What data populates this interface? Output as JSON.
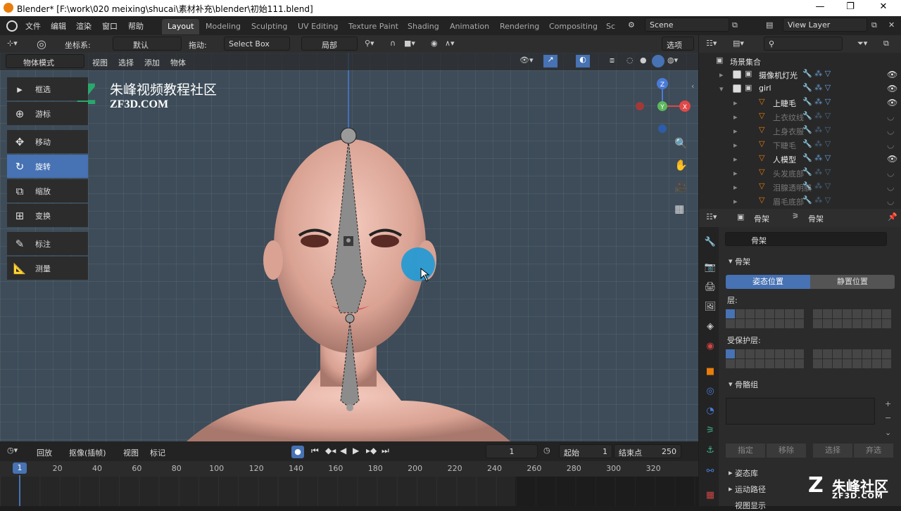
{
  "titlebar": {
    "title": "Blender* [F:\\work\\020 meixing\\shucai\\素材补充\\blender\\初始111.blend]",
    "min": "—",
    "max": "❐",
    "close": "✕"
  },
  "menu": {
    "items": [
      "文件",
      "编辑",
      "渲染",
      "窗口",
      "帮助"
    ]
  },
  "workspaces": [
    "Layout",
    "Modeling",
    "Sculpting",
    "UV Editing",
    "Texture Paint",
    "Shading",
    "Animation",
    "Rendering",
    "Compositing",
    "Sc"
  ],
  "scene": {
    "label": "Scene"
  },
  "viewlayer": {
    "label": "View Layer"
  },
  "viewport_header": {
    "coord_label": "坐标系:",
    "coord_value": "默认",
    "drag_label": "拖动:",
    "drag_value": "Select Box",
    "local_label": "局部",
    "options": "选项",
    "mode": "物体模式",
    "menus": [
      "视图",
      "选择",
      "添加",
      "物体"
    ]
  },
  "watermark": {
    "title": "朱峰视频教程社区",
    "url": "ZF3D.COM"
  },
  "bottom_logo": {
    "text": "朱峰社区",
    "url": "ZF3D.COM"
  },
  "tools": [
    {
      "icon": "▸",
      "label": "框选"
    },
    {
      "icon": "⊕",
      "label": "游标"
    },
    {
      "icon": "✥",
      "label": "移动"
    },
    {
      "icon": "↻",
      "label": "旋转",
      "active": true
    },
    {
      "icon": "⧉",
      "label": "缩放"
    },
    {
      "icon": "⊞",
      "label": "变换"
    },
    {
      "icon": "✎",
      "label": "标注"
    },
    {
      "icon": "📐",
      "label": "测量"
    }
  ],
  "gizmo": {
    "z": "Z",
    "y": "Y",
    "x": "X"
  },
  "outliner": {
    "root": "场景集合",
    "items": [
      {
        "label": "摄像机灯光",
        "indent": 0,
        "visible": true
      },
      {
        "label": "girl",
        "indent": 0,
        "visible": true,
        "expanded": true
      },
      {
        "label": "上睫毛",
        "indent": 1,
        "visible": true
      },
      {
        "label": "上衣纹线",
        "indent": 1,
        "visible": false
      },
      {
        "label": "上身衣服",
        "indent": 1,
        "visible": false
      },
      {
        "label": "下睫毛",
        "indent": 1,
        "visible": false
      },
      {
        "label": "人模型",
        "indent": 1,
        "visible": true
      },
      {
        "label": "头发底部",
        "indent": 1,
        "visible": false
      },
      {
        "label": "泪腺透明膜",
        "indent": 1,
        "visible": false
      },
      {
        "label": "眉毛底部",
        "indent": 1,
        "visible": false
      }
    ]
  },
  "properties": {
    "header_a": "骨架",
    "header_b": "骨架",
    "name": "骨架",
    "section_skeleton": "骨架",
    "pose_position": "姿态位置",
    "rest_position": "静置位置",
    "layers": "层:",
    "protected_layers": "受保护层:",
    "bone_groups": "骨骼组",
    "assign": "指定",
    "remove": "移除",
    "select": "选择",
    "deselect": "弃选",
    "pose_library": "姿态库",
    "motion_paths": "运动路径",
    "viewport_display": "视图显示"
  },
  "timeline": {
    "menus": [
      "回放",
      "抠像(插帧)",
      "视图",
      "标记"
    ],
    "current_frame": "1",
    "start_label": "起始",
    "start": "1",
    "end_label": "结束点",
    "end": "250",
    "ruler": [
      "1",
      "20",
      "40",
      "60",
      "80",
      "100",
      "120",
      "140",
      "160",
      "180",
      "200",
      "220",
      "240",
      "260",
      "280",
      "300",
      "320"
    ]
  },
  "colors": {
    "accent": "#4772b3",
    "orange": "#e87d0d",
    "viewport_bg": "#3d4c58"
  }
}
